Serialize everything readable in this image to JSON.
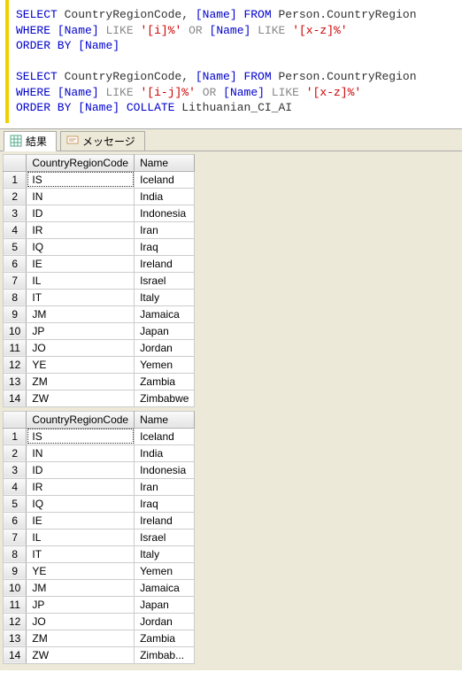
{
  "sql": {
    "q1": {
      "select": "SELECT",
      "cols": " CountryRegionCode, ",
      "nameCol": "[Name]",
      "from": " FROM ",
      "table": "Person.CountryRegion",
      "where": "WHERE",
      "likePat1": "'[i]%'",
      "or": "OR",
      "like": "LIKE",
      "likePat2": "'[x-z]%'",
      "order": "ORDER BY"
    },
    "q2": {
      "likePat1": "'[i-j]%'",
      "likePat2": "'[x-z]%'",
      "collate": "COLLATE",
      "collation": "Lithuanian_CI_AI"
    }
  },
  "tabs": {
    "results": "結果",
    "messages": "メッセージ"
  },
  "headers": {
    "code": "CountryRegionCode",
    "name": "Name"
  },
  "grid1": [
    {
      "c": "IS",
      "n": "Iceland"
    },
    {
      "c": "IN",
      "n": "India"
    },
    {
      "c": "ID",
      "n": "Indonesia"
    },
    {
      "c": "IR",
      "n": "Iran"
    },
    {
      "c": "IQ",
      "n": "Iraq"
    },
    {
      "c": "IE",
      "n": "Ireland"
    },
    {
      "c": "IL",
      "n": "Israel"
    },
    {
      "c": "IT",
      "n": "Italy"
    },
    {
      "c": "JM",
      "n": "Jamaica"
    },
    {
      "c": "JP",
      "n": "Japan"
    },
    {
      "c": "JO",
      "n": "Jordan"
    },
    {
      "c": "YE",
      "n": "Yemen"
    },
    {
      "c": "ZM",
      "n": "Zambia"
    },
    {
      "c": "ZW",
      "n": "Zimbabwe"
    }
  ],
  "grid2": [
    {
      "c": "IS",
      "n": "Iceland"
    },
    {
      "c": "IN",
      "n": "India"
    },
    {
      "c": "ID",
      "n": "Indonesia"
    },
    {
      "c": "IR",
      "n": "Iran"
    },
    {
      "c": "IQ",
      "n": "Iraq"
    },
    {
      "c": "IE",
      "n": "Ireland"
    },
    {
      "c": "IL",
      "n": "Israel"
    },
    {
      "c": "IT",
      "n": "Italy"
    },
    {
      "c": "YE",
      "n": "Yemen"
    },
    {
      "c": "JM",
      "n": "Jamaica"
    },
    {
      "c": "JP",
      "n": "Japan"
    },
    {
      "c": "JO",
      "n": "Jordan"
    },
    {
      "c": "ZM",
      "n": "Zambia"
    },
    {
      "c": "ZW",
      "n": "Zimbab..."
    }
  ]
}
